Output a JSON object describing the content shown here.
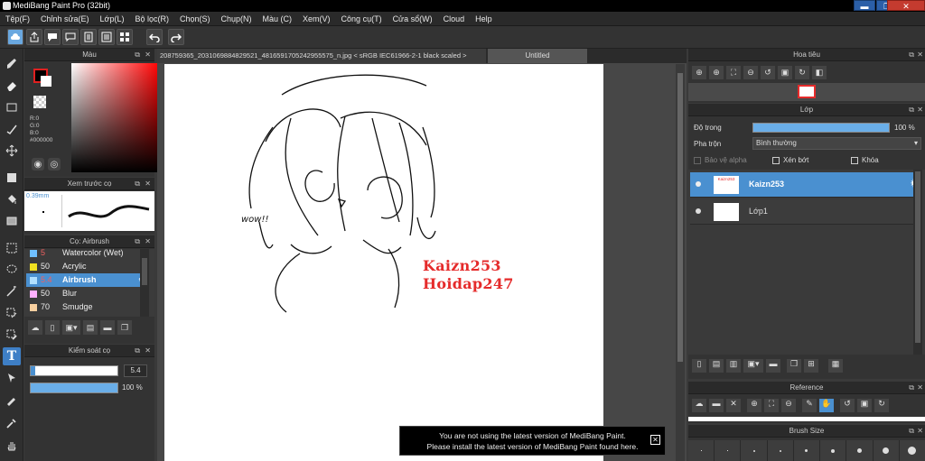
{
  "window": {
    "title": "MediBang Paint Pro (32bit)",
    "minimize": "▬",
    "maximize": "❐",
    "close": "✕"
  },
  "menu": [
    "Tệp(F)",
    "Chỉnh sửa(E)",
    "Lớp(L)",
    "Bộ lọc(R)",
    "Chọn(S)",
    "Chụp(N)",
    "Màu (C)",
    "Xem(V)",
    "Công cụ(T)",
    "Cửa sổ(W)",
    "Cloud",
    "Help"
  ],
  "color_panel": {
    "title": "Màu",
    "r": "R:0",
    "g": "G:0",
    "b": "B:0",
    "hex": "#000000"
  },
  "brush_preview": {
    "title": "Xem trước cọ",
    "size": "0.39mm"
  },
  "brush_panel": {
    "title": "Cọ: Airbrush",
    "items": [
      {
        "size": "5",
        "name": "Watercolor (Wet)",
        "color": "#6fc0ff"
      },
      {
        "size": "50",
        "name": "Acrylic",
        "color": "#f0e020"
      },
      {
        "size": "5.4",
        "name": "Airbrush",
        "color": "#b0e0ff"
      },
      {
        "size": "50",
        "name": "Blur",
        "color": "#ffb0ff"
      },
      {
        "size": "70",
        "name": "Smudge",
        "color": "#f8d0a0"
      }
    ]
  },
  "brush_control": {
    "title": "Kiểm soát cọ",
    "size_value": "5.4",
    "opacity_value": "100 %",
    "size_level": 0.05,
    "opacity_level": 1.0
  },
  "document": {
    "tab_file": "208759365_2031069884829521_4816591705242955575_n.jpg < sRGB IEC61966-2-1 black scaled >",
    "tab_untitled": "Untitled",
    "drawing_text_1": "Kaizn253",
    "drawing_text_2": "Hoidap247",
    "drawing_wow": "wow!!"
  },
  "notice": {
    "line1": "You are not using the latest version of MediBang Paint.",
    "line2": "Please install the latest version of MediBang Paint found here."
  },
  "navigator": {
    "title": "Hoa tiêu"
  },
  "layer_panel": {
    "title": "Lớp",
    "opacity_label": "Độ trong",
    "opacity_value": "100 %",
    "opacity_level": 1.0,
    "blend_label": "Pha trộn",
    "blend_value": "Bình thường",
    "alpha_lock": "Bảo vệ alpha",
    "clipping": "Xén bớt",
    "lock": "Khóa",
    "layers": [
      {
        "name": "Kaizn253",
        "thumb": "Kaizn253"
      },
      {
        "name": "Lớp1"
      }
    ]
  },
  "reference_panel": {
    "title": "Reference"
  },
  "brush_size_panel": {
    "title": "Brush Size"
  }
}
